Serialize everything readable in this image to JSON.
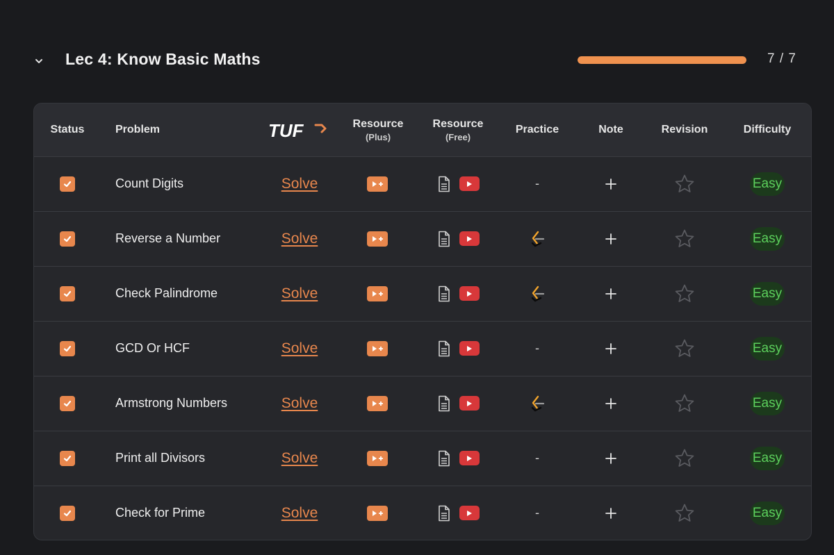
{
  "section": {
    "title": "Lec 4: Know Basic Maths",
    "progress_text": "7 / 7",
    "progress_fraction": 1.0,
    "accent_color": "#f0924f"
  },
  "table": {
    "headers": {
      "status": "Status",
      "problem": "Problem",
      "tuf_logo": "TUF",
      "resource_plus": "Resource",
      "resource_plus_sub": "(Plus)",
      "resource_free": "Resource",
      "resource_free_sub": "(Free)",
      "practice": "Practice",
      "note": "Note",
      "revision": "Revision",
      "difficulty": "Difficulty"
    },
    "solve_label": "Solve",
    "rows": [
      {
        "name": "Count Digits",
        "done": true,
        "practice": "-",
        "difficulty": "Easy"
      },
      {
        "name": "Reverse a Number",
        "done": true,
        "practice": "leetcode-icon",
        "difficulty": "Easy"
      },
      {
        "name": "Check Palindrome",
        "done": true,
        "practice": "leetcode-icon",
        "difficulty": "Easy"
      },
      {
        "name": "GCD Or HCF",
        "done": true,
        "practice": "-",
        "difficulty": "Easy"
      },
      {
        "name": "Armstrong Numbers",
        "done": true,
        "practice": "leetcode-icon",
        "difficulty": "Easy"
      },
      {
        "name": "Print all Divisors",
        "done": true,
        "practice": "-",
        "difficulty": "Easy"
      },
      {
        "name": "Check for Prime",
        "done": true,
        "practice": "-",
        "difficulty": "Easy"
      }
    ]
  },
  "colors": {
    "checkbox": "#e8874d",
    "youtube": "#d8383a",
    "easy_text": "#5cd05c",
    "easy_bg": "#1c3a1c"
  }
}
